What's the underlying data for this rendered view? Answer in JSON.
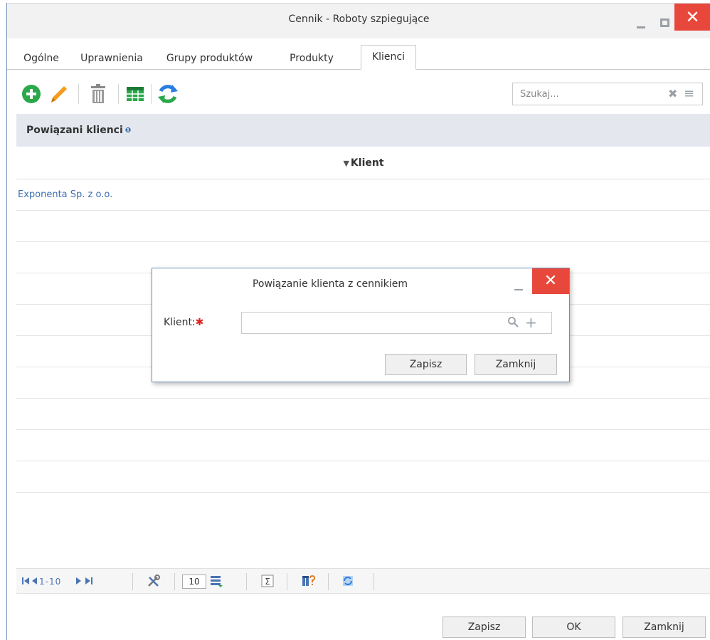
{
  "window": {
    "title": "Cennik - Roboty szpiegujące",
    "close_glyph": "✕"
  },
  "tabs": [
    {
      "label": "Ogólne"
    },
    {
      "label": "Uprawnienia"
    },
    {
      "label": "Grupy produktów"
    },
    {
      "label": "Produkty"
    },
    {
      "label": "Klienci",
      "active": true
    }
  ],
  "toolbar": {
    "icons": [
      "add-icon",
      "edit-pencil-icon",
      "delete-trash-icon",
      "table-view-icon",
      "refresh-icon"
    ]
  },
  "search": {
    "placeholder": "Szukaj...",
    "clear_glyph": "✖",
    "menu_glyph": "≡"
  },
  "grid": {
    "header": "Powiązani klienci",
    "info_glyph": "❶",
    "column": {
      "caret": "▼",
      "label": "Klient"
    },
    "rows": [
      {
        "client": "Exponenta Sp. z o.o."
      },
      {
        "client": ""
      },
      {
        "client": ""
      },
      {
        "client": ""
      },
      {
        "client": ""
      },
      {
        "client": ""
      },
      {
        "client": ""
      },
      {
        "client": ""
      },
      {
        "client": ""
      },
      {
        "client": ""
      }
    ]
  },
  "pager": {
    "range": "1-10",
    "page_size": "10"
  },
  "modal": {
    "title": "Powiązanie klienta z cennikiem",
    "close_glyph": "✕",
    "field_label": "Klient:",
    "required_mark": "✱",
    "add_glyph": "+",
    "save_label": "Zapisz",
    "close_label": "Zamknij"
  },
  "footer": {
    "save_label": "Zapisz",
    "ok_label": "OK",
    "close_label": "Zamknij"
  },
  "colors": {
    "accent_blue": "#3d6fb0",
    "close_red": "#e8483c",
    "add_green": "#2aa84a",
    "pencil_orange": "#f39c1f"
  }
}
